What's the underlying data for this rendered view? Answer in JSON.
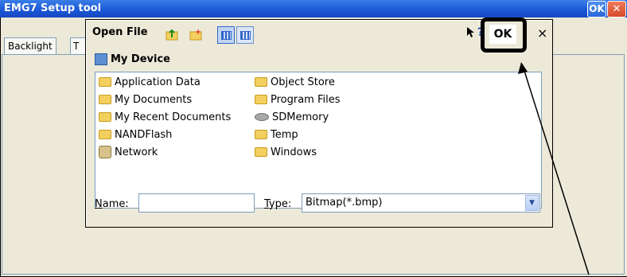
{
  "app": {
    "title": "EMG7 Setup tool",
    "ok_label": "OK",
    "close_label": "✕",
    "tabs": [
      {
        "label": "Backlight"
      },
      {
        "label": "T"
      }
    ]
  },
  "dialog": {
    "title": "Open File",
    "toolbar": {
      "up_folder_icon": "up-folder-icon",
      "new_folder_icon": "new-folder-icon",
      "list_view_icon": "list-view-icon",
      "details_view_icon": "details-view-icon"
    },
    "help_label": "?",
    "ok_label": "OK",
    "close_label": "×",
    "location": "My Device",
    "files": [
      {
        "name": "Application Data",
        "icon": "folder-icon"
      },
      {
        "name": "My Documents",
        "icon": "folder-icon"
      },
      {
        "name": "My Recent Documents",
        "icon": "folder-icon"
      },
      {
        "name": "NANDFlash",
        "icon": "folder-icon"
      },
      {
        "name": "Network",
        "icon": "network-icon"
      },
      {
        "name": "Object Store",
        "icon": "folder-icon"
      },
      {
        "name": "Program Files",
        "icon": "folder-icon"
      },
      {
        "name": "SDMemory",
        "icon": "drive-icon"
      },
      {
        "name": "Temp",
        "icon": "folder-icon"
      },
      {
        "name": "Windows",
        "icon": "folder-icon"
      }
    ],
    "name_label_prefix": "N",
    "name_label_rest": "ame:",
    "name_value": "",
    "type_label_prefix": "T",
    "type_label_rest": "ype:",
    "type_value": "Bitmap(*.bmp)"
  },
  "colors": {
    "titlebar": "#1a56d4",
    "dialog_bg": "#ece9d8",
    "highlight_border": "#000000"
  }
}
